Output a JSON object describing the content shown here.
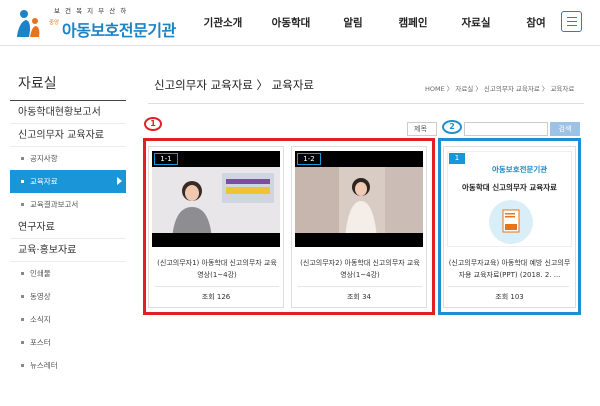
{
  "header": {
    "logo_tagline": "보 건 복 지 부 산 하",
    "logo_small": "중앙",
    "logo_name": "아동보호전문기관",
    "nav": [
      "기관소개",
      "아동학대",
      "알림",
      "캠페인",
      "자료실",
      "참여"
    ]
  },
  "sidebar": {
    "title": "자료실",
    "items": [
      {
        "label": "아동학대현황보고서",
        "type": "main"
      },
      {
        "label": "신고의무자 교육자료",
        "type": "main"
      },
      {
        "label": "공지사항",
        "type": "sub"
      },
      {
        "label": "교육자료",
        "type": "sub",
        "active": true
      },
      {
        "label": "교육결과보고서",
        "type": "sub"
      },
      {
        "label": "연구자료",
        "type": "main"
      },
      {
        "label": "교육·홍보자료",
        "type": "main"
      },
      {
        "label": "인쇄물",
        "type": "sub"
      },
      {
        "label": "동영상",
        "type": "sub"
      },
      {
        "label": "소식지",
        "type": "sub"
      },
      {
        "label": "포스터",
        "type": "sub"
      },
      {
        "label": "뉴스레터",
        "type": "sub"
      }
    ]
  },
  "page": {
    "title": "신고의무자 교육자료 〉 교육자료",
    "breadcrumb": "HOME 〉 자료실 〉 신고의무자 교육자료 〉 교육자료"
  },
  "search": {
    "select_label": "제목",
    "button_label": "검색"
  },
  "cards": [
    {
      "badge": "1-1",
      "title": "(신고의무자1) 아동학대 신고의무자 교육 영상(1~4강)",
      "views": "조회 126"
    },
    {
      "badge": "1-2",
      "title": "(신고의무자2) 아동학대 신고의무자 교육 영상(1~4강)",
      "views": "조회 34"
    },
    {
      "badge": "1",
      "logo": "아동보호전문기관",
      "heading": "아동학대 신고의무자 교육자료",
      "title": "(신고의무자교육) 아동학대 예방 신고의무자용 교육자료(PPT) (2018. 2. ...",
      "views": "조회 103"
    }
  ],
  "annotations": {
    "red_label": "1",
    "blue_label": "2"
  },
  "colors": {
    "brand_blue": "#1b84c6",
    "active_bg": "#1a96d8",
    "annotation_red": "#e41e26",
    "annotation_blue": "#1e8fd1"
  }
}
